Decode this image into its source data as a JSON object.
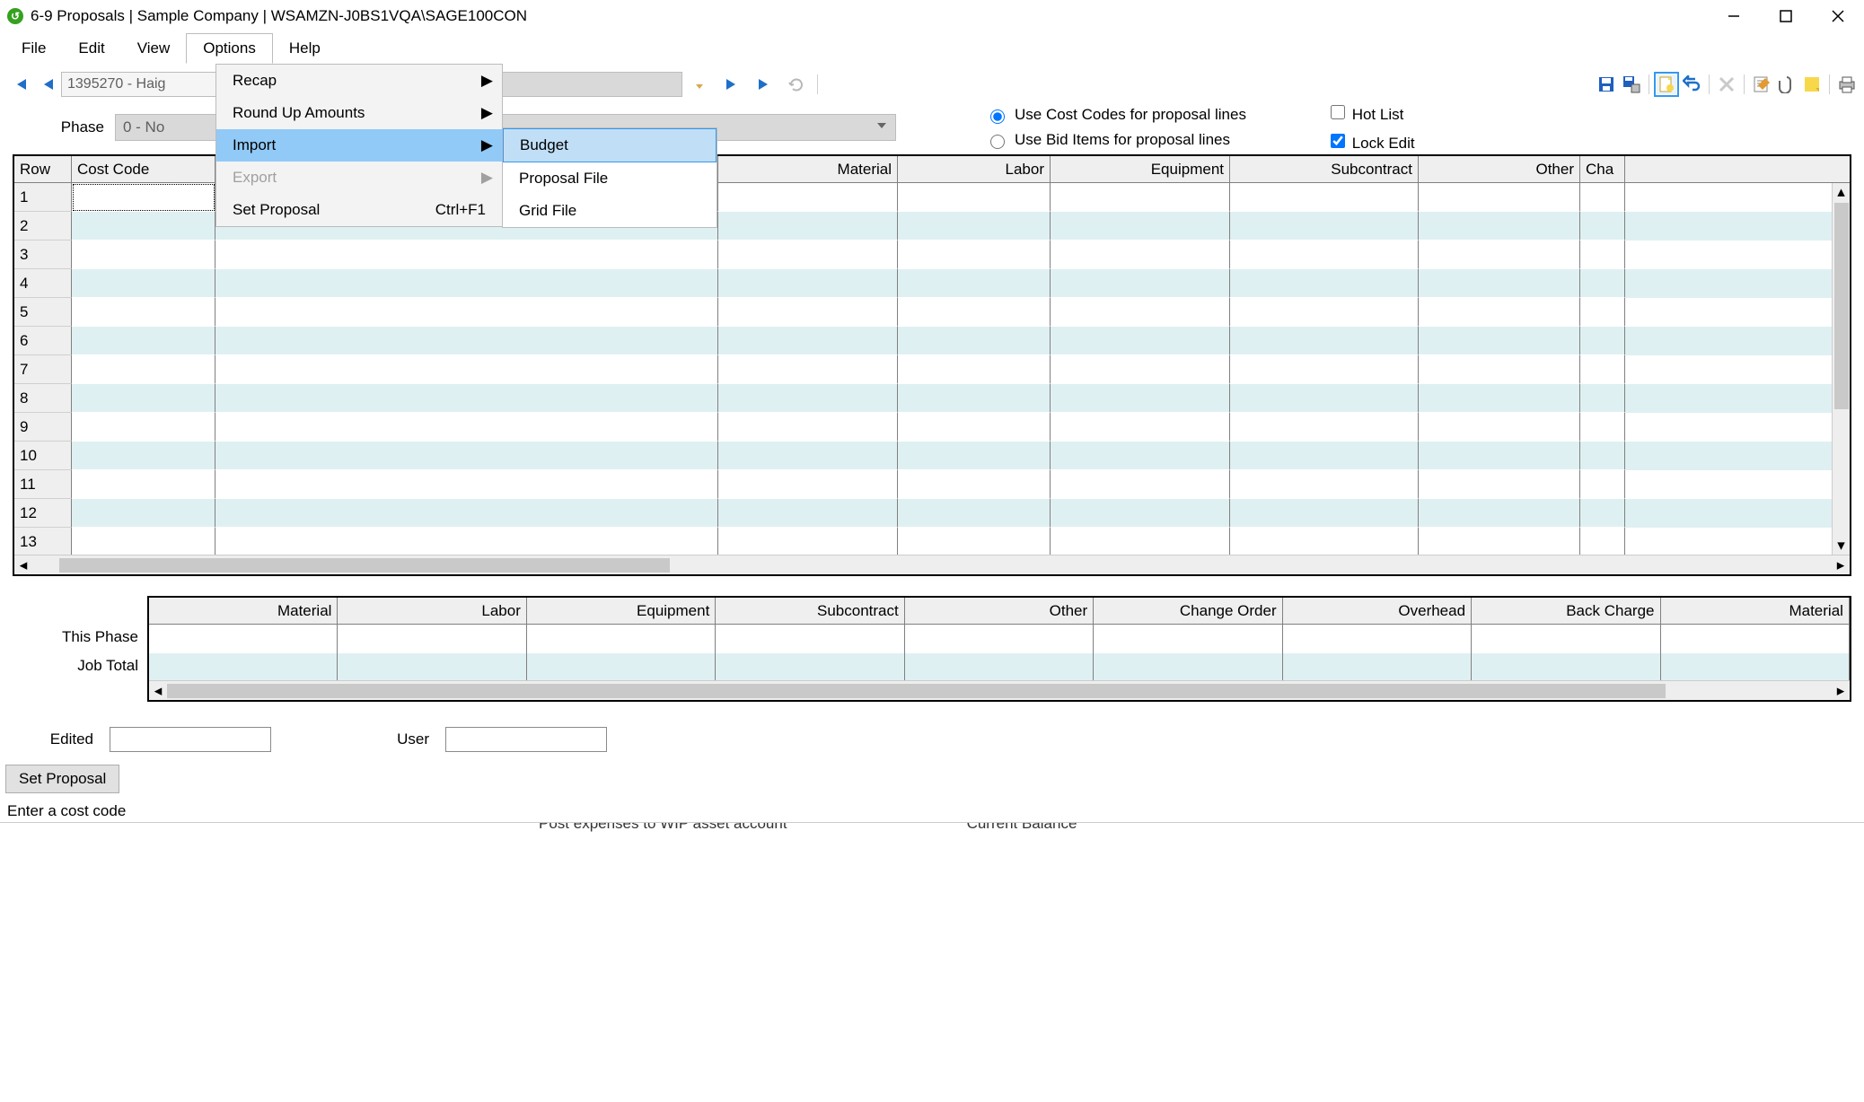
{
  "window_title": "6-9 Proposals  |  Sample Company  |  WSAMZN-J0BS1VQA\\SAGE100CON",
  "menu": {
    "file": "File",
    "edit": "Edit",
    "view": "View",
    "options": "Options",
    "help": "Help"
  },
  "options_submenu": {
    "recap": "Recap",
    "roundup": "Round Up Amounts",
    "import": "Import",
    "export": "Export",
    "set_proposal": "Set Proposal",
    "set_proposal_shortcut": "Ctrl+F1"
  },
  "import_submenu": {
    "budget": "Budget",
    "proposal_file": "Proposal File",
    "grid_file": "Grid File"
  },
  "record_box": "1395270 - Haig",
  "phase": {
    "label": "Phase",
    "value": "0 - No"
  },
  "radios": {
    "cost_codes": "Use Cost Codes for proposal lines",
    "bid_items": "Use Bid Items for proposal lines",
    "selected": "cost_codes"
  },
  "checks": {
    "hot_list": "Hot List",
    "lock_edit": "Lock Edit"
  },
  "grid_columns": {
    "row": "Row",
    "cost_code": "Cost Code",
    "material": "Material",
    "labor": "Labor",
    "equipment": "Equipment",
    "subcontract": "Subcontract",
    "other": "Other",
    "cha": "Cha"
  },
  "grid_rows": [
    "1",
    "2",
    "3",
    "4",
    "5",
    "6",
    "7",
    "8",
    "9",
    "10",
    "11",
    "12",
    "13"
  ],
  "summary_columns": [
    "Material",
    "Labor",
    "Equipment",
    "Subcontract",
    "Other",
    "Change Order",
    "Overhead",
    "Back Charge",
    "Material"
  ],
  "summary_labels": {
    "this_phase": "This Phase",
    "job_total": "Job Total"
  },
  "footer": {
    "edited_label": "Edited",
    "user_label": "User",
    "set_proposal_btn": "Set Proposal"
  },
  "status_text": "Enter a cost code",
  "cutoff": {
    "left": "Post expenses to WIP asset account",
    "right": "Current Balance"
  }
}
